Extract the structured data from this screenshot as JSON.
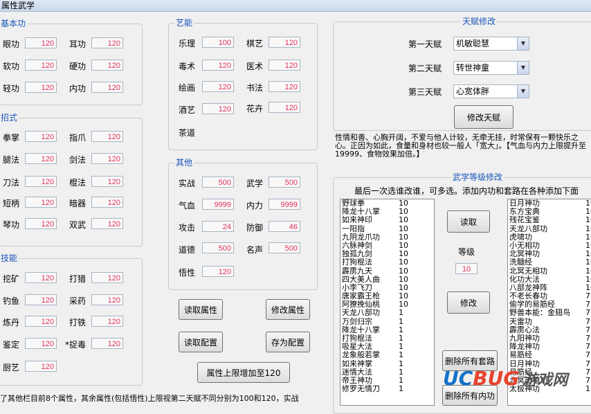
{
  "window": {
    "title": "属性武学"
  },
  "basic": {
    "title": "基本功",
    "fields": [
      {
        "label": "眼功",
        "value": "120"
      },
      {
        "label": "耳功",
        "value": "120"
      },
      {
        "label": "软功",
        "value": "120"
      },
      {
        "label": "硬功",
        "value": "120"
      },
      {
        "label": "轻功",
        "value": "120"
      },
      {
        "label": "内功",
        "value": "120"
      }
    ]
  },
  "moves": {
    "title": "招式",
    "fields": [
      {
        "label": "拳掌",
        "value": "120"
      },
      {
        "label": "指爪",
        "value": "120"
      },
      {
        "label": "腿法",
        "value": "120"
      },
      {
        "label": "剑法",
        "value": "120"
      },
      {
        "label": "刀法",
        "value": "120"
      },
      {
        "label": "棍法",
        "value": "120"
      },
      {
        "label": "短柄",
        "value": "120"
      },
      {
        "label": "暗器",
        "value": "120"
      },
      {
        "label": "琴功",
        "value": "120"
      },
      {
        "label": "双武",
        "value": "120"
      }
    ]
  },
  "skills": {
    "title": "技能",
    "fields": [
      {
        "label": "挖矿",
        "value": "120"
      },
      {
        "label": "打猎",
        "value": "120"
      },
      {
        "label": "钓鱼",
        "value": "120"
      },
      {
        "label": "采药",
        "value": "120"
      },
      {
        "label": "炼丹",
        "value": "120"
      },
      {
        "label": "打铁",
        "value": "120"
      },
      {
        "label": "鉴定",
        "value": "120"
      },
      {
        "label": "*捉毒",
        "value": "120"
      },
      {
        "label": "厨艺",
        "value": "120"
      }
    ]
  },
  "arts": {
    "title": "艺能",
    "fields": [
      {
        "label": "乐理",
        "value": "100"
      },
      {
        "label": "棋艺",
        "value": "120"
      },
      {
        "label": "毒术",
        "value": "120"
      },
      {
        "label": "医术",
        "value": "120"
      },
      {
        "label": "绘画",
        "value": "120"
      },
      {
        "label": "书法",
        "value": "120"
      },
      {
        "label": "酒艺",
        "value": "120"
      },
      {
        "label": "花卉",
        "value": "120"
      },
      {
        "label": "茶道",
        "value": "120"
      }
    ]
  },
  "other": {
    "title": "其他",
    "fields": [
      {
        "label": "实战",
        "value": "500"
      },
      {
        "label": "武学",
        "value": "500"
      },
      {
        "label": "气血",
        "value": "9999"
      },
      {
        "label": "内力",
        "value": "9999"
      },
      {
        "label": "攻击",
        "value": "24"
      },
      {
        "label": "防御",
        "value": "46"
      },
      {
        "label": "道德",
        "value": "500"
      },
      {
        "label": "名声",
        "value": "500"
      },
      {
        "label": "悟性",
        "value": "120"
      }
    ]
  },
  "buttons": {
    "read_attr": "读取属性",
    "modify_attr": "修改属性",
    "read_config": "读取配置",
    "save_config": "存为配置",
    "raise_limit": "属性上限增加至120"
  },
  "talent": {
    "title": "天赋修改",
    "items": [
      {
        "label": "第一天赋",
        "value": "机敏聪慧"
      },
      {
        "label": "第二天赋",
        "value": "转世神童"
      },
      {
        "label": "第三天赋",
        "value": "心宽体胖"
      }
    ],
    "button": "修改天赋",
    "description": "性情和善、心胸开阔，不爱与他人计较，无牵无挂，时常保有一颗快乐之心。正因为如此，食量和身材也较一般人「宽大」。【气血与内力上限提升至19999、食物效果加倍。】"
  },
  "martial": {
    "title": "武学等级修改",
    "hint": "最后一次选谁改谁，可多选。添加内功和套路在各种添加下面",
    "left_list": [
      {
        "name": "野球拳",
        "level": "10"
      },
      {
        "name": "降龙十八掌",
        "level": "10"
      },
      {
        "name": "如来神印",
        "level": "10"
      },
      {
        "name": "一阳指",
        "level": "10"
      },
      {
        "name": "九阴龙爪功",
        "level": "10"
      },
      {
        "name": "六脉神剑",
        "level": "10"
      },
      {
        "name": "独孤九剑",
        "level": "10"
      },
      {
        "name": "打狗棍法",
        "level": "10"
      },
      {
        "name": "霹雳九天",
        "level": "10"
      },
      {
        "name": "四大美人曲",
        "level": "10"
      },
      {
        "name": "小李飞刀",
        "level": "10"
      },
      {
        "name": "唐家霸王枪",
        "level": "10"
      },
      {
        "name": "阿獠挽仙桃",
        "level": "10"
      },
      {
        "name": "天龙八部功",
        "level": "1"
      },
      {
        "name": "万剑归宗",
        "level": "1"
      },
      {
        "name": "降龙十八掌",
        "level": "1"
      },
      {
        "name": "打狗棍法",
        "level": "1"
      },
      {
        "name": "吸星大法",
        "level": "1"
      },
      {
        "name": "龙象般若掌",
        "level": "1"
      },
      {
        "name": "如来神掌",
        "level": "1"
      },
      {
        "name": "迷情大法",
        "level": "1"
      },
      {
        "name": "帝王神功",
        "level": "1"
      },
      {
        "name": "修罗无情刀",
        "level": "1"
      }
    ],
    "read_button": "读取",
    "level_label": "等级",
    "level_value": "10",
    "modify_button": "修改",
    "delete_sets_button": "删除所有套路",
    "delete_inner_button": "删除所有内功",
    "right_list": [
      {
        "name": "日月神功",
        "level": "10"
      },
      {
        "name": "东方宝典",
        "level": "10"
      },
      {
        "name": "残花宝鉴",
        "level": "10"
      },
      {
        "name": "天龙八部功",
        "level": "10"
      },
      {
        "name": "虎啸功",
        "level": "10"
      },
      {
        "name": "小无相功",
        "level": "10"
      },
      {
        "name": "北冥神功",
        "level": "10"
      },
      {
        "name": "洗髓经",
        "level": "10"
      },
      {
        "name": "北冥无相功",
        "level": "10"
      },
      {
        "name": "化功大法",
        "level": "10"
      },
      {
        "name": "八部龙神阵",
        "level": "10"
      },
      {
        "name": "不老长春功",
        "level": "7"
      },
      {
        "name": "偷学的易筋经",
        "level": "7"
      },
      {
        "name": "野兽本能：金翅鸟",
        "level": "7"
      },
      {
        "name": "天雷功",
        "level": "7"
      },
      {
        "name": "霹雳心法",
        "level": "7"
      },
      {
        "name": "九阳神功",
        "level": "7"
      },
      {
        "name": "降龙神功",
        "level": "7"
      },
      {
        "name": "易筋经",
        "level": "7"
      },
      {
        "name": "日月神功",
        "level": "7"
      },
      {
        "name": "易筋经",
        "level": "7"
      },
      {
        "name": "北冥无相功",
        "level": "7"
      },
      {
        "name": "太极神功",
        "level": "1"
      }
    ]
  },
  "footer_note": "了其他栏目前8个属性，其余属性(包括悟性)上限视第二天赋不同分别为100和120，实战",
  "watermark": {
    "part1": "UC",
    "part2": "BUG",
    "part3": "游戏网"
  },
  "colors": {
    "value_text": "#e0325f",
    "group_title": "#1a55b8"
  }
}
